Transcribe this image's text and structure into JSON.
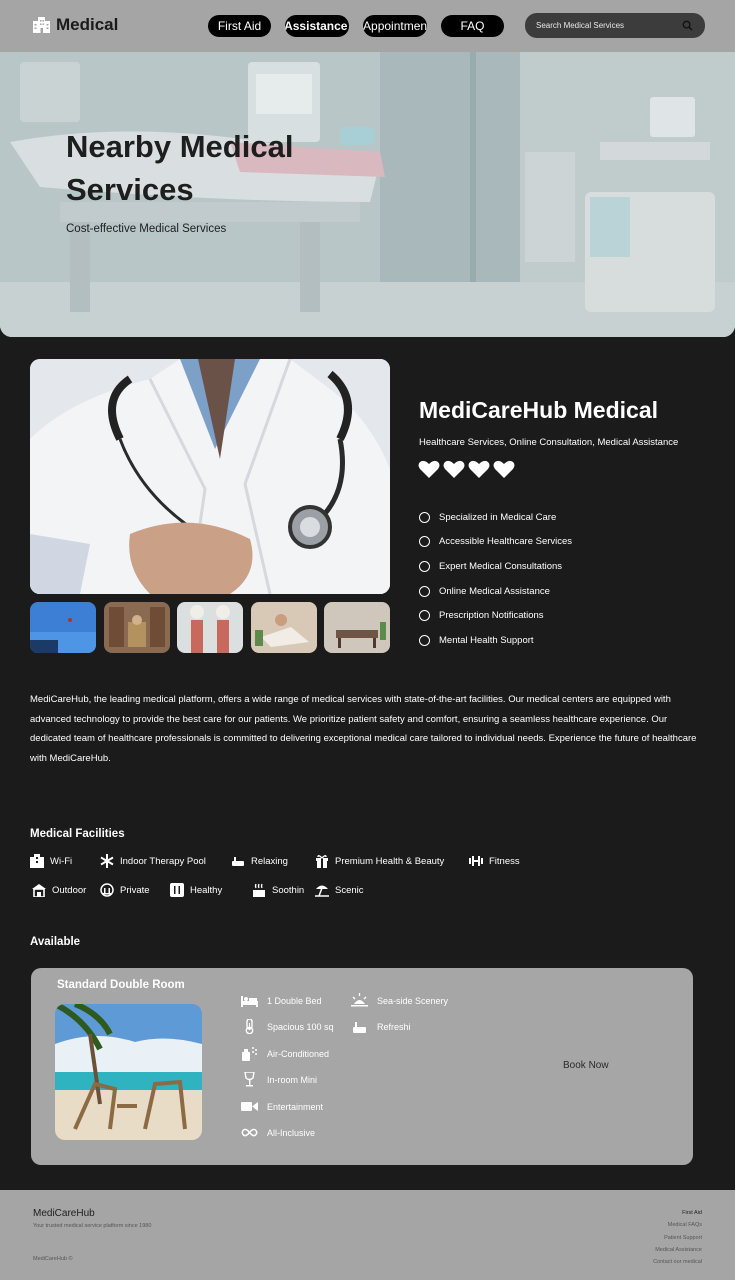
{
  "header": {
    "brand": "Medical",
    "nav": [
      "First Aid",
      "Personal Assistance",
      "Book Appointment",
      "FAQ"
    ],
    "search_placeholder": "Search Medical Services"
  },
  "hero": {
    "title": "Nearby Medical Services",
    "subtitle": "Cost-effective Medical Services"
  },
  "listing": {
    "title": "MediCareHub Medical",
    "tags": "Healthcare Services, Online Consultation, Medical Assistance",
    "rating": 4,
    "features": [
      "Specialized in Medical Care",
      "Accessible Healthcare Services",
      "Expert Medical Consultations",
      "Online Medical Assistance",
      "Prescription Notifications",
      "Mental Health Support"
    ],
    "description": "MediCareHub, the leading medical platform, offers a wide range of medical services with state-of-the-art facilities. Our medical centers are equipped with advanced technology to provide the best care for our patients. We prioritize patient safety and comfort, ensuring a seamless healthcare experience. Our dedicated team of healthcare professionals is committed to delivering exceptional medical care tailored to individual needs. Experience the future of healthcare with MediCareHub."
  },
  "facilities": {
    "title": "Medical Facilities",
    "items": [
      {
        "label": "Wi-Fi",
        "icon": "building-icon"
      },
      {
        "label": "Indoor Therapy Pool",
        "icon": "snowflake-icon"
      },
      {
        "label": "Relaxing",
        "icon": "bath-icon"
      },
      {
        "label": "Premium Health & Beauty",
        "icon": "gift-icon"
      },
      {
        "label": "Fitness",
        "icon": "dumbbell-icon"
      },
      {
        "label": "Outdoor",
        "icon": "house-icon"
      },
      {
        "label": "Private",
        "icon": "landmark-icon"
      },
      {
        "label": "Healthy",
        "icon": "utensils-icon"
      },
      {
        "label": "Soothin",
        "icon": "hot-tub-icon"
      },
      {
        "label": "Scenic",
        "icon": "umbrella-beach-icon"
      }
    ]
  },
  "available": {
    "title": "Available",
    "room": {
      "name": "Standard Double Room",
      "amenities_left": [
        {
          "label": "1 Double Bed",
          "icon": "bed-icon"
        },
        {
          "label": "Spacious 100 sq",
          "icon": "thermometer-icon"
        },
        {
          "label": "Air-Conditioned",
          "icon": "spray-can-icon"
        },
        {
          "label": "In-room Mini",
          "icon": "wine-glass-icon"
        },
        {
          "label": "Entertainment",
          "icon": "video-icon"
        },
        {
          "label": "All-Inclusive",
          "icon": "infinity-icon"
        }
      ],
      "amenities_right": [
        {
          "label": "Sea-side Scenery",
          "icon": "sunrise-icon"
        },
        {
          "label": "Refreshi",
          "icon": "bath-icon"
        }
      ],
      "book_label": "Book Now"
    }
  },
  "footer": {
    "brand": "MediCareHub",
    "tagline": "Your trusted medical service platform since 1980",
    "copyright": "MediCareHub ©",
    "links": [
      "First Aid",
      "Medical FAQs",
      "Patient Support",
      "Medical Assistance",
      "Contact our medical"
    ]
  },
  "colors": {
    "page_bg": "#1b1b1b",
    "header_bg": "#a5a5a5",
    "card_bg": "#a6a6a6",
    "nav_pill": "#000000",
    "search_bg": "#3c3c3c"
  }
}
